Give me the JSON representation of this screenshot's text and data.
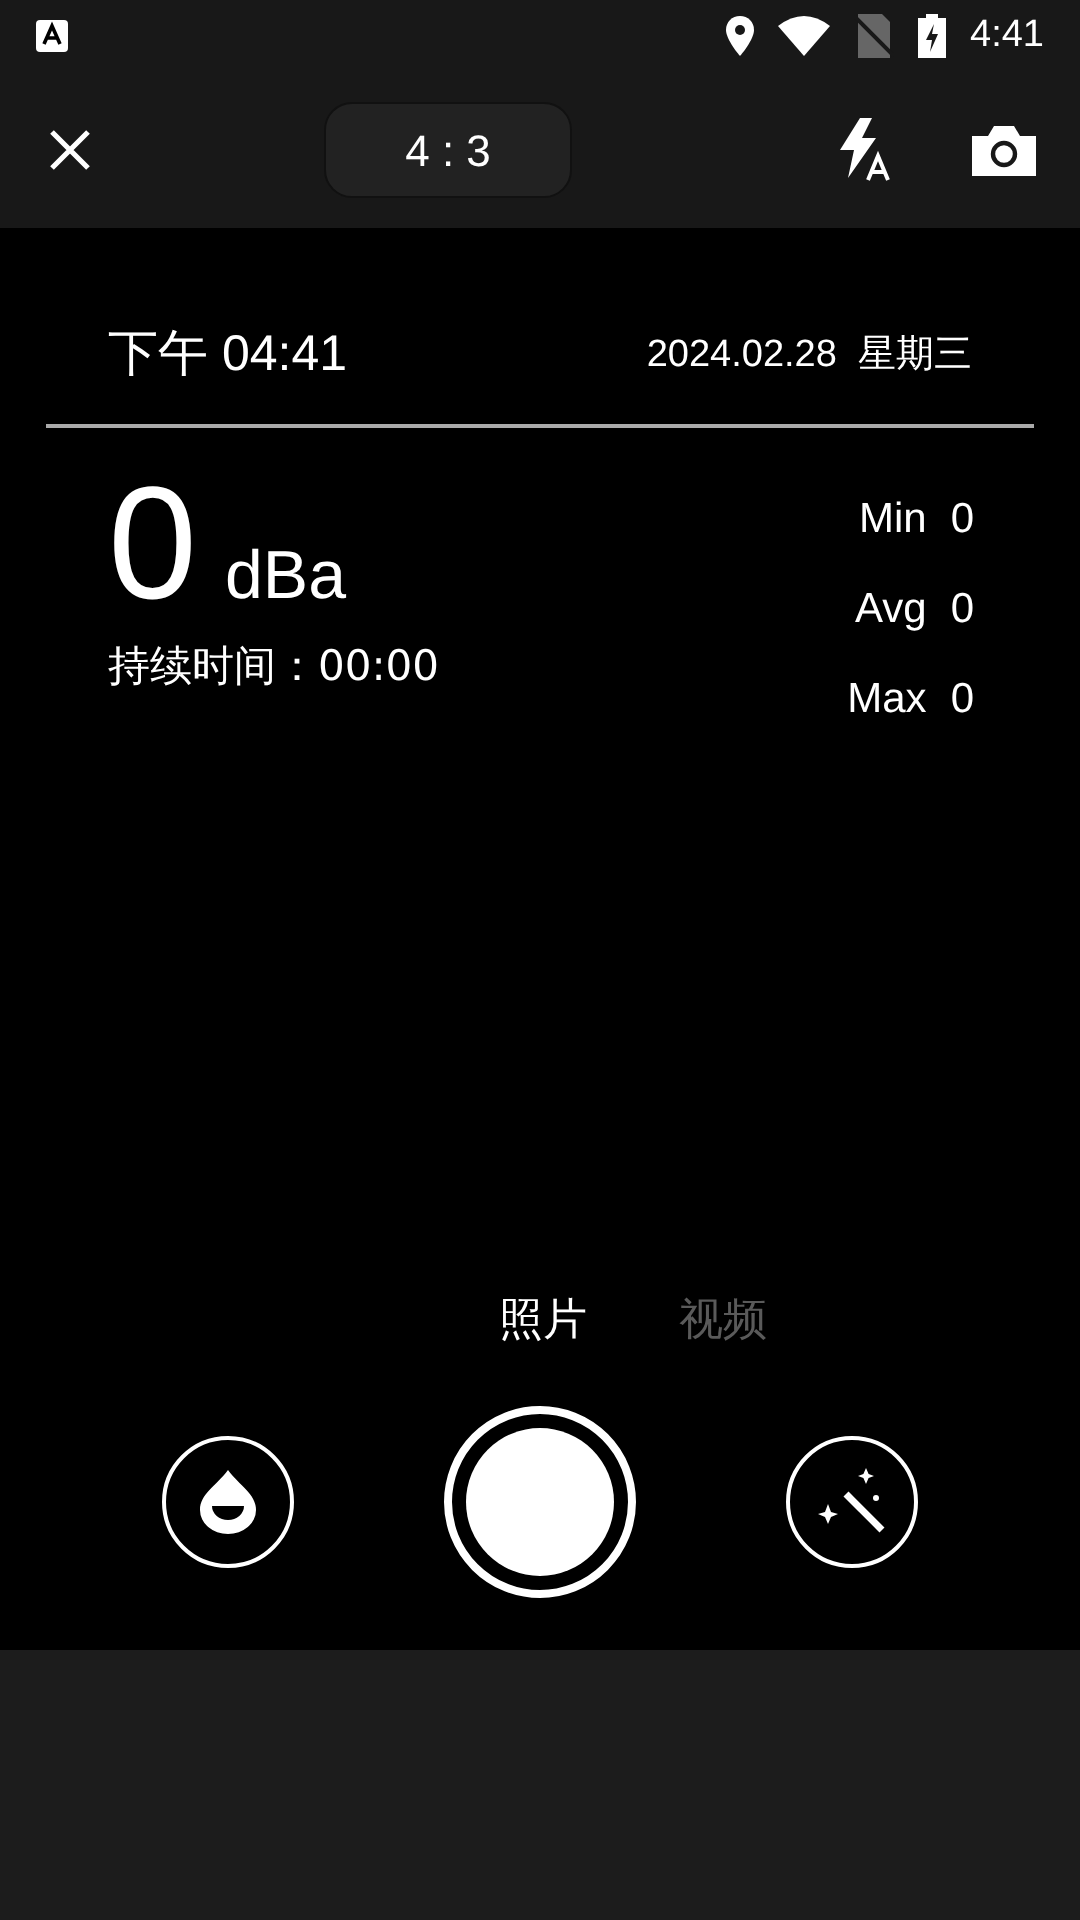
{
  "status_bar": {
    "time": "4:41"
  },
  "toolbar": {
    "ratio": "4 : 3"
  },
  "overlay": {
    "time": "下午 04:41",
    "date": "2024.02.28  星期三",
    "reading": "0",
    "unit": "dBa",
    "duration": "持续时间：00:00",
    "stats": [
      {
        "label": "Min",
        "value": "0"
      },
      {
        "label": "Avg",
        "value": "0"
      },
      {
        "label": "Max",
        "value": "0"
      }
    ]
  },
  "modes": [
    {
      "label": "照片",
      "selected": true
    },
    {
      "label": "视频",
      "selected": false
    }
  ]
}
